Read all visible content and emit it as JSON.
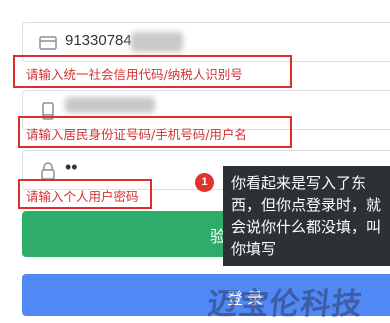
{
  "form": {
    "credit_code_field": {
      "value": "91330784",
      "error": "请输入统一社会信用代码/纳税人识别号",
      "icon": "id-card-icon"
    },
    "account_field": {
      "value": "",
      "error": "请输入居民身份证号码/手机号码/用户名",
      "icon": "phone-icon"
    },
    "password_field": {
      "value": "••",
      "error": "请输入个人用户密码",
      "icon": "lock-icon"
    },
    "confirm_button_label": "验",
    "login_button_label": "登录"
  },
  "annotation": {
    "number": "1",
    "text": "你看起来是写入了东西，但你点登录时，就会说你什么都没填，叫你填写"
  },
  "watermark": "迈宝伦科技",
  "colors": {
    "error": "#d23232",
    "highlight_box": "#e02c2c",
    "green_button": "#2eac69",
    "blue_button": "#5089f5",
    "tooltip_bg": "#2c3136",
    "badge": "#e0332e"
  }
}
